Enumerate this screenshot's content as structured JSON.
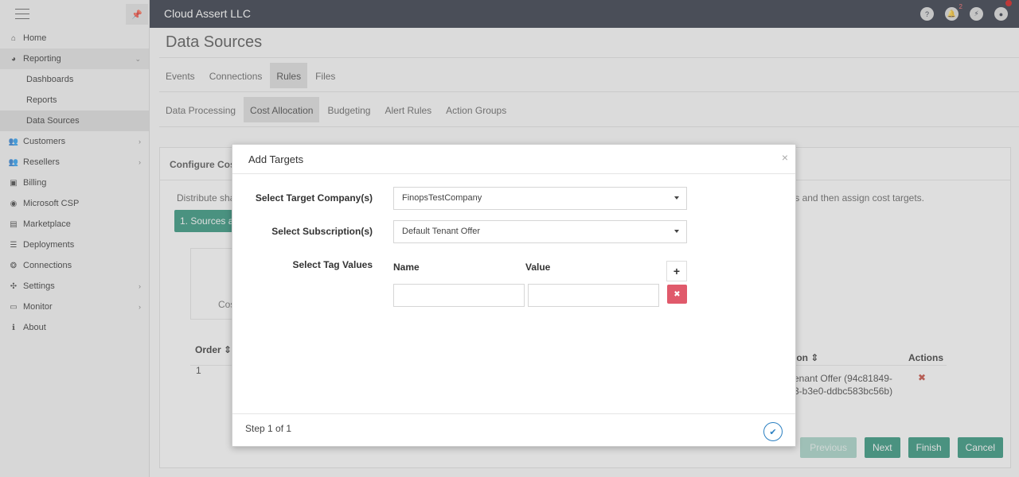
{
  "sidebar": {
    "items": [
      {
        "label": "Home",
        "icon": "home-icon",
        "glyph": "⌂"
      },
      {
        "label": "Reporting",
        "icon": "pie-chart-icon",
        "glyph": "◕",
        "chevron": "⌄"
      },
      {
        "label": "Dashboards"
      },
      {
        "label": "Reports"
      },
      {
        "label": "Data Sources"
      },
      {
        "label": "Customers",
        "icon": "users-icon",
        "glyph": "👥",
        "chevron": "›"
      },
      {
        "label": "Resellers",
        "icon": "users-icon",
        "glyph": "👥",
        "chevron": "›"
      },
      {
        "label": "Billing",
        "icon": "billing-icon",
        "glyph": "▣"
      },
      {
        "label": "Microsoft CSP",
        "icon": "globe-icon",
        "glyph": "◉"
      },
      {
        "label": "Marketplace",
        "icon": "marketplace-icon",
        "glyph": "▤"
      },
      {
        "label": "Deployments",
        "icon": "list-icon",
        "glyph": "☰"
      },
      {
        "label": "Connections",
        "icon": "connections-icon",
        "glyph": "❂"
      },
      {
        "label": "Settings",
        "icon": "settings-icon",
        "glyph": "✣",
        "chevron": "›"
      },
      {
        "label": "Monitor",
        "icon": "monitor-icon",
        "glyph": "▭",
        "chevron": "›"
      },
      {
        "label": "About",
        "icon": "info-icon",
        "glyph": "ℹ"
      }
    ]
  },
  "topbar": {
    "brand": "Cloud Assert LLC",
    "notification_count": "2"
  },
  "page": {
    "title": "Data Sources",
    "tabs": [
      "Events",
      "Connections",
      "Rules",
      "Files"
    ],
    "subtabs": [
      "Data Processing",
      "Cost Allocation",
      "Budgeting",
      "Alert Rules",
      "Action Groups"
    ]
  },
  "panel": {
    "heading": "Configure Cos",
    "description": "Distribute sha",
    "description_tail": "ags and then assign cost targets.",
    "step_chip": "1. Sources an",
    "card_label": "Cos",
    "col_order": "Order ⇕",
    "col_action": "ion ⇕",
    "col_actions": "Actions",
    "row_order": "1",
    "row_sub_line1": "enant Offer (94c81849-",
    "row_sub_line2": "3-b3e0-ddbc583bc56b)",
    "row_delete": "✖"
  },
  "wizard": {
    "previous": "Previous",
    "next": "Next",
    "finish": "Finish",
    "cancel": "Cancel"
  },
  "modal": {
    "title": "Add Targets",
    "close": "×",
    "company_label": "Select Target Company(s)",
    "company_value": "FinopsTestCompany",
    "subscription_label": "Select Subscription(s)",
    "subscription_value": "Default Tenant Offer",
    "tag_label": "Select Tag Values",
    "name_col": "Name",
    "value_col": "Value",
    "add_glyph": "+",
    "remove_glyph": "✖",
    "step": "Step 1 of 1",
    "ok_glyph": "✔"
  }
}
